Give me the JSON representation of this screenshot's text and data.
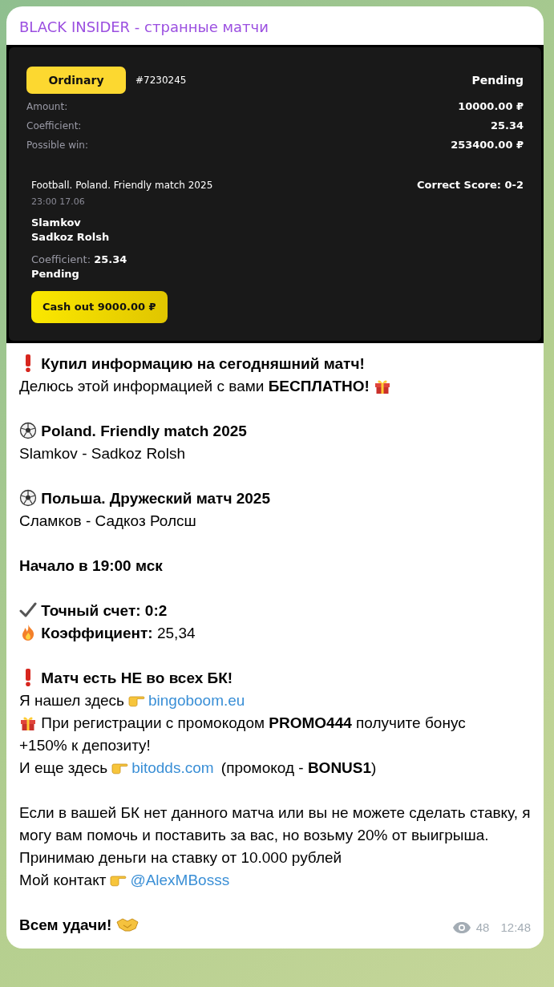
{
  "channel_title": "BLACK INSIDER - странные матчи",
  "bet_slip": {
    "type_badge": "Ordinary",
    "bet_id": "#7230245",
    "status": "Pending",
    "summary": [
      {
        "label": "Amount:",
        "value": "10000.00 ₽"
      },
      {
        "label": "Coefficient:",
        "value": "25.34"
      },
      {
        "label": "Possible win:",
        "value": "253400.00 ₽"
      }
    ],
    "event": {
      "name": "Football. Poland. Friendly match 2025",
      "time": "23:00 17.06",
      "team_1": "Slamkov",
      "team_2": "Sadkoz Rolsh",
      "coefficient_label": "Coefficient:",
      "coefficient": "25.34",
      "status": "Pending",
      "market": "Correct Score: 0-2"
    },
    "cash_out_button": "Cash out 9000.00 ₽"
  },
  "message": {
    "paragraphs": [
      [
        {
          "parts": [
            {
              "kind": "exclaim"
            },
            {
              "kind": "bold",
              "text": "Купил информацию на сегодняшний матч!"
            }
          ]
        },
        {
          "parts": [
            {
              "kind": "text",
              "text": "Делюсь этой информацией с вами **БЕСПЛАТНО!**"
            },
            {
              "kind": "gift"
            }
          ]
        }
      ],
      [
        {
          "parts": [
            {
              "kind": "ball"
            },
            {
              "kind": "bold",
              "text": "Poland. Friendly match 2025"
            }
          ]
        },
        {
          "parts": [
            {
              "kind": "text",
              "text": "Slamkov - Sadkoz Rolsh"
            }
          ]
        }
      ],
      [
        {
          "parts": [
            {
              "kind": "ball"
            },
            {
              "kind": "bold",
              "text": "Польша. Дружеский матч 2025"
            }
          ]
        },
        {
          "parts": [
            {
              "kind": "text",
              "text": "Сламков - Садкоз Ролсш"
            }
          ]
        }
      ],
      [
        {
          "parts": [
            {
              "kind": "bold",
              "text": "Начало в 19:00 мск"
            }
          ]
        }
      ],
      [
        {
          "parts": [
            {
              "kind": "check"
            },
            {
              "kind": "bold",
              "text": "Точный счет: 0:2"
            }
          ]
        },
        {
          "parts": [
            {
              "kind": "fire"
            },
            {
              "kind": "text",
              "text": "**Коэффициент:** 25,34"
            }
          ]
        }
      ],
      [
        {
          "parts": [
            {
              "kind": "exclaim"
            },
            {
              "kind": "bold",
              "text": "Матч есть НЕ во всех БК!"
            }
          ]
        },
        {
          "parts": [
            {
              "kind": "text",
              "text": "Я нашел здесь"
            },
            {
              "kind": "point"
            },
            {
              "kind": "link",
              "text": "bingoboom.eu"
            }
          ]
        },
        {
          "parts": [
            {
              "kind": "gift"
            },
            {
              "kind": "text",
              "text": "При регистрации с промокодом **PROMO444** получите бонус"
            }
          ]
        },
        {
          "parts": [
            {
              "kind": "text",
              "text": "+150% к депозиту!"
            }
          ]
        },
        {
          "parts": [
            {
              "kind": "text",
              "text": "И еще здесь"
            },
            {
              "kind": "point"
            },
            {
              "kind": "link",
              "text": "bitodds.com"
            },
            {
              "kind": "text",
              "text": "(промокод - **BONUS1**)"
            }
          ]
        }
      ],
      [
        {
          "parts": [
            {
              "kind": "text",
              "text": "Если в вашей БК нет данного матча или вы не можете сделать ставку, я могу вам помочь и поставить за вас, но возьму 20% от выигрыша."
            }
          ]
        },
        {
          "parts": [
            {
              "kind": "text",
              "text": "Принимаю деньги на ставку от 10.000 рублей"
            }
          ]
        },
        {
          "parts": [
            {
              "kind": "text",
              "text": "Мой контакт"
            },
            {
              "kind": "point"
            },
            {
              "kind": "link",
              "text": "@AlexMBosss"
            }
          ]
        }
      ],
      [
        {
          "parts": [
            {
              "kind": "bold",
              "text": "Всем удачи!"
            },
            {
              "kind": "handshake"
            }
          ]
        }
      ]
    ]
  },
  "views": "48",
  "time": "12:48"
}
